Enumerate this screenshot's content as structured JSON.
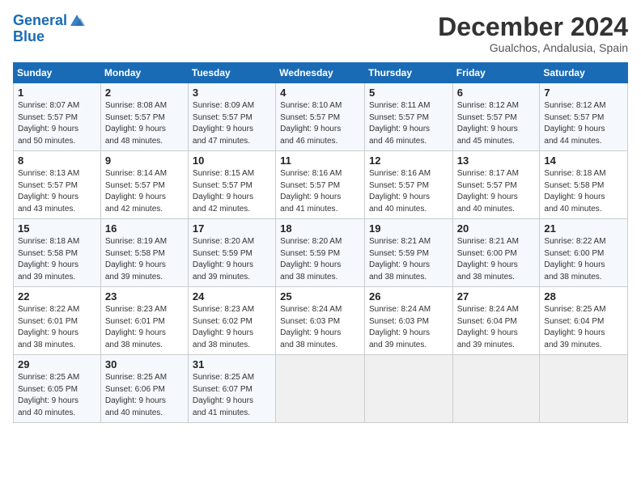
{
  "header": {
    "logo_line1": "General",
    "logo_line2": "Blue",
    "month": "December 2024",
    "location": "Gualchos, Andalusia, Spain"
  },
  "weekdays": [
    "Sunday",
    "Monday",
    "Tuesday",
    "Wednesday",
    "Thursday",
    "Friday",
    "Saturday"
  ],
  "weeks": [
    [
      {
        "day": "1",
        "info": "Sunrise: 8:07 AM\nSunset: 5:57 PM\nDaylight: 9 hours\nand 50 minutes."
      },
      {
        "day": "2",
        "info": "Sunrise: 8:08 AM\nSunset: 5:57 PM\nDaylight: 9 hours\nand 48 minutes."
      },
      {
        "day": "3",
        "info": "Sunrise: 8:09 AM\nSunset: 5:57 PM\nDaylight: 9 hours\nand 47 minutes."
      },
      {
        "day": "4",
        "info": "Sunrise: 8:10 AM\nSunset: 5:57 PM\nDaylight: 9 hours\nand 46 minutes."
      },
      {
        "day": "5",
        "info": "Sunrise: 8:11 AM\nSunset: 5:57 PM\nDaylight: 9 hours\nand 46 minutes."
      },
      {
        "day": "6",
        "info": "Sunrise: 8:12 AM\nSunset: 5:57 PM\nDaylight: 9 hours\nand 45 minutes."
      },
      {
        "day": "7",
        "info": "Sunrise: 8:12 AM\nSunset: 5:57 PM\nDaylight: 9 hours\nand 44 minutes."
      }
    ],
    [
      {
        "day": "8",
        "info": "Sunrise: 8:13 AM\nSunset: 5:57 PM\nDaylight: 9 hours\nand 43 minutes."
      },
      {
        "day": "9",
        "info": "Sunrise: 8:14 AM\nSunset: 5:57 PM\nDaylight: 9 hours\nand 42 minutes."
      },
      {
        "day": "10",
        "info": "Sunrise: 8:15 AM\nSunset: 5:57 PM\nDaylight: 9 hours\nand 42 minutes."
      },
      {
        "day": "11",
        "info": "Sunrise: 8:16 AM\nSunset: 5:57 PM\nDaylight: 9 hours\nand 41 minutes."
      },
      {
        "day": "12",
        "info": "Sunrise: 8:16 AM\nSunset: 5:57 PM\nDaylight: 9 hours\nand 40 minutes."
      },
      {
        "day": "13",
        "info": "Sunrise: 8:17 AM\nSunset: 5:57 PM\nDaylight: 9 hours\nand 40 minutes."
      },
      {
        "day": "14",
        "info": "Sunrise: 8:18 AM\nSunset: 5:58 PM\nDaylight: 9 hours\nand 40 minutes."
      }
    ],
    [
      {
        "day": "15",
        "info": "Sunrise: 8:18 AM\nSunset: 5:58 PM\nDaylight: 9 hours\nand 39 minutes."
      },
      {
        "day": "16",
        "info": "Sunrise: 8:19 AM\nSunset: 5:58 PM\nDaylight: 9 hours\nand 39 minutes."
      },
      {
        "day": "17",
        "info": "Sunrise: 8:20 AM\nSunset: 5:59 PM\nDaylight: 9 hours\nand 39 minutes."
      },
      {
        "day": "18",
        "info": "Sunrise: 8:20 AM\nSunset: 5:59 PM\nDaylight: 9 hours\nand 38 minutes."
      },
      {
        "day": "19",
        "info": "Sunrise: 8:21 AM\nSunset: 5:59 PM\nDaylight: 9 hours\nand 38 minutes."
      },
      {
        "day": "20",
        "info": "Sunrise: 8:21 AM\nSunset: 6:00 PM\nDaylight: 9 hours\nand 38 minutes."
      },
      {
        "day": "21",
        "info": "Sunrise: 8:22 AM\nSunset: 6:00 PM\nDaylight: 9 hours\nand 38 minutes."
      }
    ],
    [
      {
        "day": "22",
        "info": "Sunrise: 8:22 AM\nSunset: 6:01 PM\nDaylight: 9 hours\nand 38 minutes."
      },
      {
        "day": "23",
        "info": "Sunrise: 8:23 AM\nSunset: 6:01 PM\nDaylight: 9 hours\nand 38 minutes."
      },
      {
        "day": "24",
        "info": "Sunrise: 8:23 AM\nSunset: 6:02 PM\nDaylight: 9 hours\nand 38 minutes."
      },
      {
        "day": "25",
        "info": "Sunrise: 8:24 AM\nSunset: 6:03 PM\nDaylight: 9 hours\nand 38 minutes."
      },
      {
        "day": "26",
        "info": "Sunrise: 8:24 AM\nSunset: 6:03 PM\nDaylight: 9 hours\nand 39 minutes."
      },
      {
        "day": "27",
        "info": "Sunrise: 8:24 AM\nSunset: 6:04 PM\nDaylight: 9 hours\nand 39 minutes."
      },
      {
        "day": "28",
        "info": "Sunrise: 8:25 AM\nSunset: 6:04 PM\nDaylight: 9 hours\nand 39 minutes."
      }
    ],
    [
      {
        "day": "29",
        "info": "Sunrise: 8:25 AM\nSunset: 6:05 PM\nDaylight: 9 hours\nand 40 minutes."
      },
      {
        "day": "30",
        "info": "Sunrise: 8:25 AM\nSunset: 6:06 PM\nDaylight: 9 hours\nand 40 minutes."
      },
      {
        "day": "31",
        "info": "Sunrise: 8:25 AM\nSunset: 6:07 PM\nDaylight: 9 hours\nand 41 minutes."
      },
      {
        "day": "",
        "info": ""
      },
      {
        "day": "",
        "info": ""
      },
      {
        "day": "",
        "info": ""
      },
      {
        "day": "",
        "info": ""
      }
    ]
  ]
}
